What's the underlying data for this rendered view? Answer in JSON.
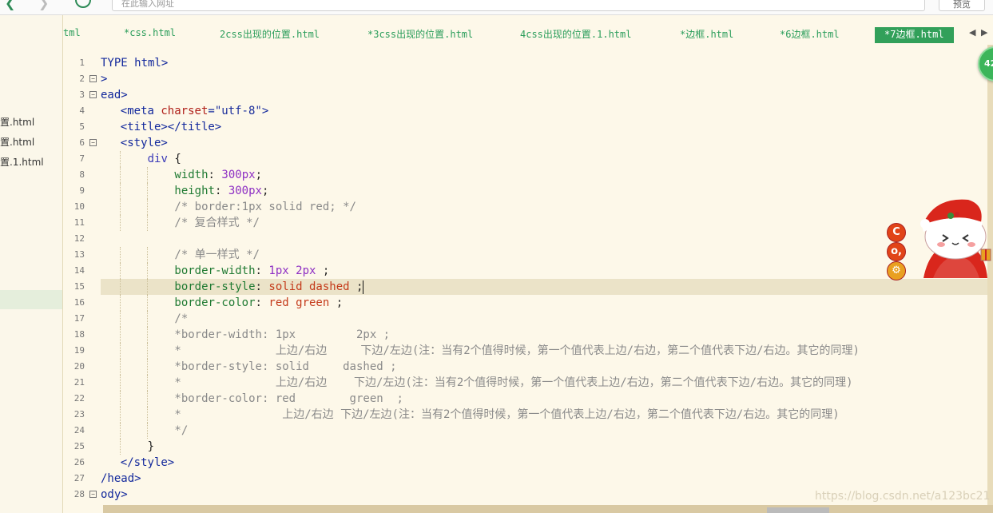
{
  "toolbar": {
    "address_placeholder": "在此输入网址",
    "preview_label": "预览"
  },
  "sidebar": {
    "items": [
      {
        "label": "置.html"
      },
      {
        "label": "置.html"
      },
      {
        "label": "置.1.html"
      }
    ]
  },
  "tabs": [
    {
      "label": "tml"
    },
    {
      "label": "*css.html"
    },
    {
      "label": "2css出现的位置.html"
    },
    {
      "label": "*3css出现的位置.html"
    },
    {
      "label": "4css出现的位置.1.html"
    },
    {
      "label": "*边框.html"
    },
    {
      "label": "*6边框.html"
    },
    {
      "label": "*7边框.html",
      "active": true
    }
  ],
  "badge": {
    "count": "42"
  },
  "mascot": {
    "buttons": [
      "C",
      "o,",
      "⚙"
    ]
  },
  "editor": {
    "current_line": 15,
    "lines": [
      {
        "n": "1",
        "text": "TYPE html>"
      },
      {
        "n": "2",
        "text": ">"
      },
      {
        "n": "3",
        "text": "ead>"
      },
      {
        "n": "4",
        "text": "<meta charset=\"utf-8\">"
      },
      {
        "n": "5",
        "text": "<title></title>"
      },
      {
        "n": "6",
        "text": "<style>"
      },
      {
        "n": "7",
        "text": "div {"
      },
      {
        "n": "8",
        "text": "width: 300px;"
      },
      {
        "n": "9",
        "text": "height: 300px;"
      },
      {
        "n": "10",
        "text": "/* border:1px solid red; */"
      },
      {
        "n": "11",
        "text": "/* 复合样式 */"
      },
      {
        "n": "12",
        "text": ""
      },
      {
        "n": "13",
        "text": "/* 单一样式 */"
      },
      {
        "n": "14",
        "text": "border-width: 1px 2px ;"
      },
      {
        "n": "15",
        "text": "border-style: solid dashed ;"
      },
      {
        "n": "16",
        "text": "border-color: red green ;"
      },
      {
        "n": "17",
        "text": "/*"
      },
      {
        "n": "18",
        "text": "*border-width: 1px         2px ;"
      },
      {
        "n": "19",
        "text": "*              上边/右边     下边/左边(注：当有2个值得时候，第一个值代表上边/右边，第二个值代表下边/右边。其它的同理)"
      },
      {
        "n": "20",
        "text": "*border-style: solid     dashed ;"
      },
      {
        "n": "21",
        "text": "*              上边/右边    下边/左边(注：当有2个值得时候，第一个值代表上边/右边，第二个值代表下边/右边。其它的同理)"
      },
      {
        "n": "22",
        "text": "*border-color: red        green  ;"
      },
      {
        "n": "23",
        "text": "*               上边/右边 下边/左边(注：当有2个值得时候，第一个值代表上边/右边，第二个值代表下边/右边。其它的同理)"
      },
      {
        "n": "24",
        "text": "*/"
      },
      {
        "n": "25",
        "text": "}"
      },
      {
        "n": "26",
        "text": "</style>"
      },
      {
        "n": "27",
        "text": "/head>"
      },
      {
        "n": "28",
        "text": "ody>"
      }
    ]
  },
  "watermark": "https://blog.csdn.net/a123bc21"
}
